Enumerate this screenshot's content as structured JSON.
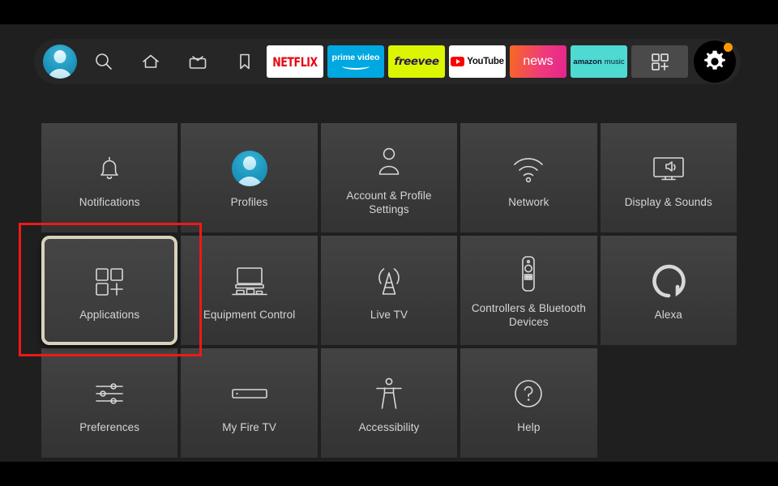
{
  "screen": {
    "background_color": "#1f1f1f",
    "letterbox_color": "#000000"
  },
  "navbar": {
    "avatar": {
      "name": "profile-avatar"
    },
    "icons": [
      {
        "name": "search-icon",
        "label": "Search"
      },
      {
        "name": "home-icon",
        "label": "Home"
      },
      {
        "name": "live-tv-icon",
        "label": "Live TV"
      },
      {
        "name": "bookmark-icon",
        "label": "Watchlist"
      }
    ],
    "apps": [
      {
        "name": "netflix",
        "label": "NETFLIX",
        "bg": "#ffffff",
        "fg": "#e50914"
      },
      {
        "name": "prime-video",
        "label": "prime video",
        "bg": "#00a8e1",
        "fg": "#ffffff"
      },
      {
        "name": "freevee",
        "label": "freevee",
        "bg": "#dbf600",
        "fg": "#2b1a52"
      },
      {
        "name": "youtube",
        "label": "YouTube",
        "bg": "#ffffff",
        "fg": "#111111"
      },
      {
        "name": "news",
        "label": "news",
        "bg": "#ef3b7a",
        "fg": "#ffffff"
      },
      {
        "name": "amazon-music",
        "label_1": "amazon",
        "label_2": "music",
        "bg": "#4fd9d3",
        "fg": "#0b1b2b"
      }
    ],
    "apps_grid_button": {
      "name": "add-apps-button",
      "label": ""
    },
    "settings_button": {
      "name": "settings-gear-button",
      "label": "Settings",
      "selected": true,
      "badge_color": "#ff9900"
    }
  },
  "grid": {
    "focused_tile": "Applications",
    "annotation_color": "#f01818",
    "focus_ring_color": "#d9d2bb",
    "tiles": [
      {
        "id": "notifications",
        "label": "Notifications",
        "icon": "bell-icon"
      },
      {
        "id": "profiles",
        "label": "Profiles",
        "icon": "profile-avatar-icon"
      },
      {
        "id": "account",
        "label": "Account & Profile Settings",
        "icon": "person-outline-icon"
      },
      {
        "id": "network",
        "label": "Network",
        "icon": "wifi-icon"
      },
      {
        "id": "display",
        "label": "Display & Sounds",
        "icon": "tv-speaker-icon"
      },
      {
        "id": "applications",
        "label": "Applications",
        "icon": "apps-grid-plus-icon"
      },
      {
        "id": "equipment",
        "label": "Equipment Control",
        "icon": "tv-equipment-icon"
      },
      {
        "id": "livetv",
        "label": "Live TV",
        "icon": "antenna-icon"
      },
      {
        "id": "controllers",
        "label": "Controllers & Bluetooth Devices",
        "icon": "remote-control-icon"
      },
      {
        "id": "alexa",
        "label": "Alexa",
        "icon": "alexa-ring-icon"
      },
      {
        "id": "preferences",
        "label": "Preferences",
        "icon": "sliders-icon"
      },
      {
        "id": "myfiretv",
        "label": "My Fire TV",
        "icon": "firestick-icon"
      },
      {
        "id": "accessibility",
        "label": "Accessibility",
        "icon": "accessibility-icon"
      },
      {
        "id": "help",
        "label": "Help",
        "icon": "question-mark-icon"
      }
    ]
  }
}
